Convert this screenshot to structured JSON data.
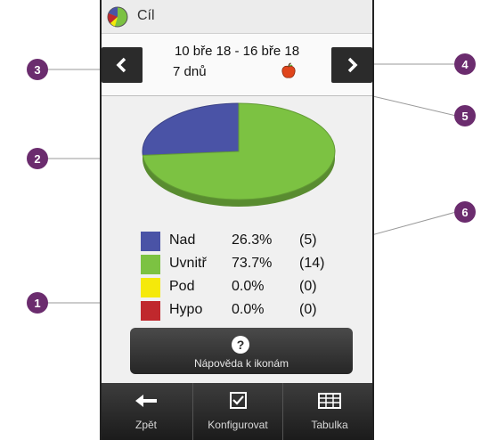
{
  "titlebar": {
    "title": "Cíl"
  },
  "range": {
    "dates": "10 bře 18 - 16 bře 18",
    "days": "7 dnů"
  },
  "chart_data": {
    "type": "pie",
    "categories": [
      "Nad",
      "Uvnitř",
      "Pod",
      "Hypo"
    ],
    "values": [
      26.3,
      73.7,
      0.0,
      0.0
    ],
    "counts": [
      5,
      14,
      0,
      0
    ],
    "colors": [
      "#4a53a6",
      "#7cc242",
      "#f5e90a",
      "#c0282d"
    ]
  },
  "legend": [
    {
      "label": "Nad",
      "pct": "26.3%",
      "count": "(5)",
      "color": "#4a53a6"
    },
    {
      "label": "Uvnitř",
      "pct": "73.7%",
      "count": "(14)",
      "color": "#7cc242"
    },
    {
      "label": "Pod",
      "pct": "0.0%",
      "count": "(0)",
      "color": "#f5e90a"
    },
    {
      "label": "Hypo",
      "pct": "0.0%",
      "count": "(0)",
      "color": "#c0282d"
    }
  ],
  "help": {
    "label": "Nápověda k ikonám",
    "icon": "question-icon"
  },
  "toolbar": {
    "back_label": "Zpět",
    "config_label": "Konfigurovat",
    "table_label": "Tabulka"
  },
  "callouts": [
    "1",
    "2",
    "3",
    "4",
    "5",
    "6"
  ],
  "accent_color": "#6b2c6e"
}
